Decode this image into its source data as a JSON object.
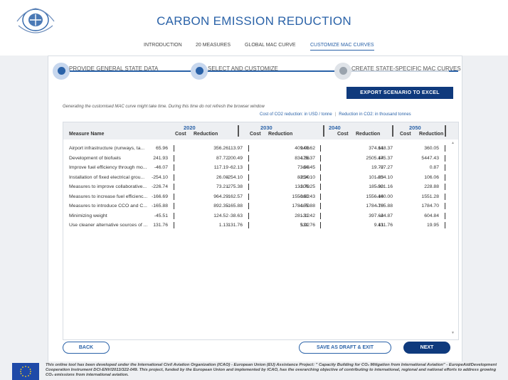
{
  "app": {
    "title": "CARBON EMISSION REDUCTION"
  },
  "nav": [
    {
      "label": "INTRODUCTION",
      "active": false
    },
    {
      "label": "20 MEASURES",
      "active": false
    },
    {
      "label": "GLOBAL MAC CURVE",
      "active": false
    },
    {
      "label": "CUSTOMIZE MAC CURVES",
      "active": true
    }
  ],
  "steps": [
    {
      "label": "PROVIDE GENERAL STATE DATA"
    },
    {
      "label": "SELECT AND CUSTOMIZE"
    },
    {
      "label": "CREATE STATE-SPECIFIC MAC CURVES"
    }
  ],
  "actions": {
    "export_label": "EXPORT SCENARIO TO EXCEL",
    "back_label": "BACK",
    "draft_label": "SAVE AS DRAFT & EXIT",
    "next_label": "NEXT"
  },
  "note": "Generating the customised MAC curve might take time. During this time do not refresh the browser window",
  "legend": {
    "cost": "Cost of CO2 reduction: in USD / tonne",
    "reduction": "Reduction in CO2: in thousand tonnes"
  },
  "table": {
    "measure_header": "Measure Name",
    "years": [
      "2020",
      "2030",
      "2040",
      "2050"
    ],
    "cost_header": "Cost",
    "reduction_header": "Reduction",
    "rows": [
      {
        "name": "Airport infrastructure (runways, ta...",
        "values": [
          [
            "65.96",
            "356.26"
          ],
          [
            "113.97",
            "409.06"
          ],
          [
            "140.62",
            "374.61"
          ],
          [
            "148.37",
            "360.05"
          ]
        ]
      },
      {
        "name": "Development of biofuels",
        "values": [
          [
            "241.93",
            "87.72"
          ],
          [
            "200.49",
            "834.36"
          ],
          [
            "175.37",
            "2505.44"
          ],
          [
            "175.37",
            "5447.43"
          ]
        ]
      },
      {
        "name": "Improve fuel efficiency through mo...",
        "values": [
          [
            "-46.07",
            "117.19"
          ],
          [
            "-62.13",
            "73.83"
          ],
          [
            "-64.45",
            "19.72"
          ],
          [
            "-97.27",
            "0.87"
          ]
        ]
      },
      {
        "name": "Installation of fixed electrical grou...",
        "values": [
          [
            "-254.10",
            "26.08"
          ],
          [
            "-254.10",
            "83.30"
          ],
          [
            "-254.10",
            "101.63"
          ],
          [
            "-254.10",
            "106.06"
          ]
        ]
      },
      {
        "name": "Measures to improve collaborative...",
        "values": [
          [
            "-226.74",
            "73.21"
          ],
          [
            "-275.38",
            "131.79"
          ],
          [
            "-306.25",
            "185.90"
          ],
          [
            "-321.16",
            "228.88"
          ]
        ]
      },
      {
        "name": "Measures to increase fuel efficienc...",
        "values": [
          [
            "-166.69",
            "964.29"
          ],
          [
            "-162.57",
            "1550.62"
          ],
          [
            "-160.43",
            "1556.44"
          ],
          [
            "-160.00",
            "1551.28"
          ]
        ]
      },
      {
        "name": "Measures to introduce CCO and C...",
        "values": [
          [
            "-165.88",
            "892.35"
          ],
          [
            "-165.88",
            "1784.70"
          ],
          [
            "-165.88",
            "1784.70"
          ],
          [
            "-165.88",
            "1784.70"
          ]
        ]
      },
      {
        "name": "Minimizing weight",
        "values": [
          [
            "-45.51",
            "124.52"
          ],
          [
            "-38.63",
            "281.12"
          ],
          [
            "-31.42",
            "397.64"
          ],
          [
            "-24.87",
            "604.84"
          ]
        ]
      },
      {
        "name": "Use cleaner alternative sources of ...",
        "values": [
          [
            "131.76",
            "1.13"
          ],
          [
            "131.76",
            "5.02"
          ],
          [
            "131.76",
            "9.41"
          ],
          [
            "131.76",
            "19.95"
          ]
        ]
      }
    ]
  },
  "footer": {
    "text": "This online tool has been developed under the International Civil Aviation Organization (ICAO) - European Union (EU) Assistance Project: \" Capacity Building for CO₂ Mitigation from International Aviation\" - EuropeAid/Development Cooperation Instrument DCI-ENV/2013/322-049. This project, funded by the European Union and implemented by ICAO, has the overarching objective of contributing to international, regional and national efforts to address growing CO₂ emissions from international aviation."
  },
  "colors": {
    "accent": "#2a62a8",
    "primary_button": "#0f3a7d",
    "eu_blue": "#1f4aa8"
  },
  "icons": [
    "icao-logo",
    "eu-flag-icon"
  ]
}
